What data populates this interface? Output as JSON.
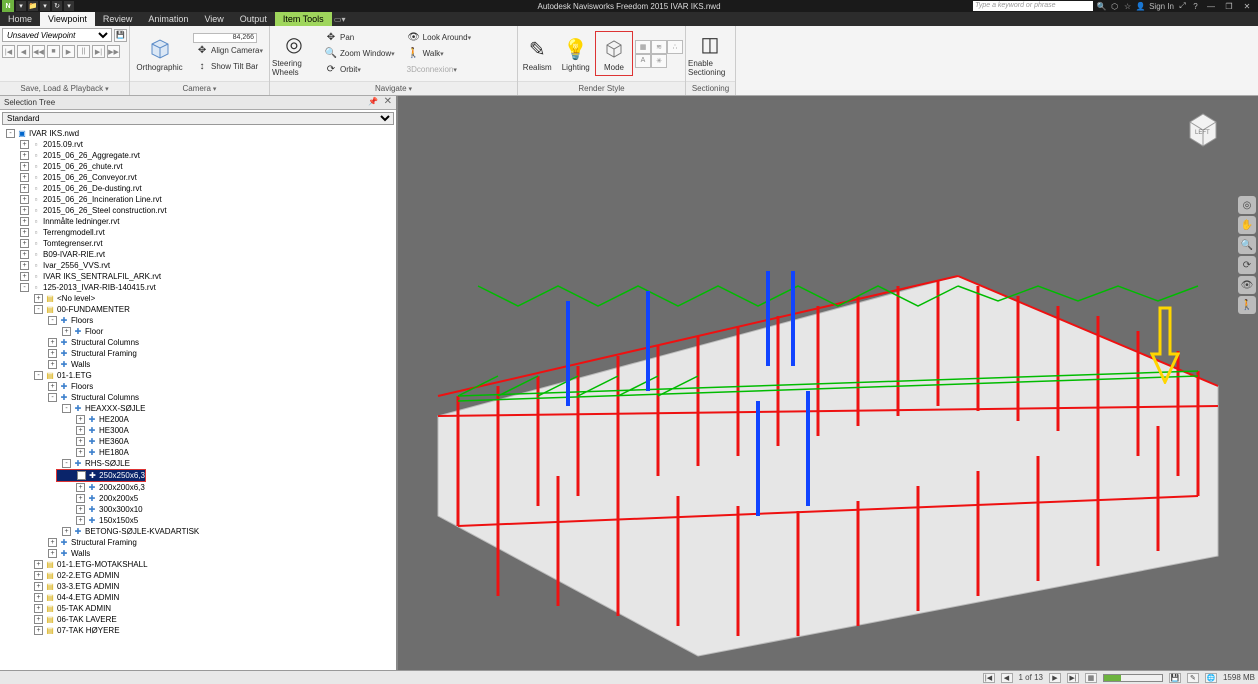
{
  "title": "Autodesk Navisworks Freedom 2015   IVAR IKS.nwd",
  "searchPlaceholder": "Type a keyword or phrase",
  "signIn": "Sign In",
  "tabs": {
    "home": "Home",
    "viewpoint": "Viewpoint",
    "review": "Review",
    "animation": "Animation",
    "view": "View",
    "output": "Output",
    "itemTools": "Item Tools"
  },
  "ribbonGroups": {
    "saveLoad": "Save, Load & Playback",
    "camera": "Camera",
    "navigate": "Navigate",
    "renderStyle": "Render Style",
    "sectioning": "Sectioning"
  },
  "ribbon": {
    "unsavedViewpoint": "Unsaved Viewpoint",
    "orthographic": "Orthographic",
    "coord": "84,266",
    "alignCamera": "Align Camera",
    "showTiltBar": "Show Tilt Bar",
    "steeringWheels": "Steering Wheels",
    "pan": "Pan",
    "zoomWindow": "Zoom Window",
    "orbit": "Orbit",
    "lookAround": "Look Around",
    "walk": "Walk",
    "dconnexion": "3Dconnexion",
    "realism": "Realism",
    "lighting": "Lighting",
    "mode": "Mode",
    "enableSectioning": "Enable Sectioning"
  },
  "selectionTree": {
    "title": "Selection Tree",
    "filter": "Standard"
  },
  "tree": {
    "root": "IVAR IKS.nwd",
    "f1": "2015.09.rvt",
    "f2": "2015_06_26_Aggregate.rvt",
    "f3": "2015_06_26_chute.rvt",
    "f4": "2015_06_26_Conveyor.rvt",
    "f5": "2015_06_26_De-dusting.rvt",
    "f6": "2015_06_26_Incineration Line.rvt",
    "f7": "2015_06_26_Steel construction.rvt",
    "f8": "Innmålte ledninger.rvt",
    "f9": "Terrengmodell.rvt",
    "f10": "Tomtegrenser.rvt",
    "f11": "B09-IVAR-RIE.rvt",
    "f12": "Ivar_2556_VVS.rvt",
    "f13": "IVAR IKS_SENTRALFIL_ARK.rvt",
    "f14": "125-2013_IVAR-RIB-140415.rvt",
    "noLevel": "<No level>",
    "l00": "00-FUNDAMENTER",
    "floors": "Floors",
    "floor": "Floor",
    "structCols": "Structural Columns",
    "structFraming": "Structural Framing",
    "walls": "Walls",
    "l01": "01-1.ETG",
    "heaxxx": "HEAXXX-SØJLE",
    "he200a": "HE200A",
    "he300a": "HE300A",
    "he360a": "HE360A",
    "he180a": "HE180A",
    "rhs": "RHS-SØJLE",
    "rhs250": "250x250x6,3",
    "rhs200": "200x200x6,3",
    "rhs200b": "200x200x5",
    "rhs300": "300x300x10",
    "rhs150": "150x150x5",
    "betong": "BETONG-SØJLE-KVADARTISK",
    "l01m": "01-1.ETG-MOTAKSHALL",
    "l02": "02-2.ETG ADMIN",
    "l03": "03-3.ETG ADMIN",
    "l04": "04-4.ETG ADMIN",
    "l05": "05-TAK ADMIN",
    "l06": "06-TAK LAVERE",
    "l07": "07-TAK HØYERE"
  },
  "status": {
    "page": "1 of 13",
    "mem": "1598 MB"
  },
  "viewcube": {
    "left": "LEFT"
  }
}
